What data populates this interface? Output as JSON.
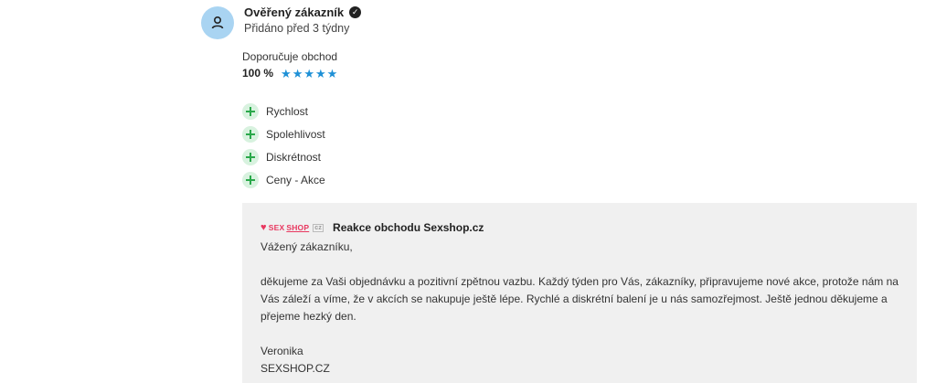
{
  "review": {
    "author": "Ověřený zákazník",
    "date": "Přidáno před 3 týdny",
    "recommend_label": "Doporučuje obchod",
    "recommend_percent": "100 %",
    "rating": 5,
    "pros": [
      "Rychlost",
      "Spolehlivost",
      "Diskrétnost",
      "Ceny - Akce"
    ]
  },
  "reply": {
    "logo_text": "SEXSHOP.cz",
    "title": "Reakce obchodu Sexshop.cz",
    "greeting": "Vážený zákazníku,",
    "body": "děkujeme za Vaši objednávku a pozitivní zpětnou vazbu. Každý týden pro Vás, zákazníky, připravujeme nové akce, protože nám na Vás záleží a víme, že v akcích se nakupuje ještě lépe. Rychlé a diskrétní balení je u nás samozřejmost. Ještě jednou děkujeme a přejeme hezký den.",
    "signature_name": "Veronika",
    "signature_company": "SEXSHOP.CZ"
  },
  "colors": {
    "star": "#1e90d6",
    "plus": "#2aa84a",
    "avatar_bg": "#a9d4f2",
    "reply_bg": "#f0f0f0"
  }
}
